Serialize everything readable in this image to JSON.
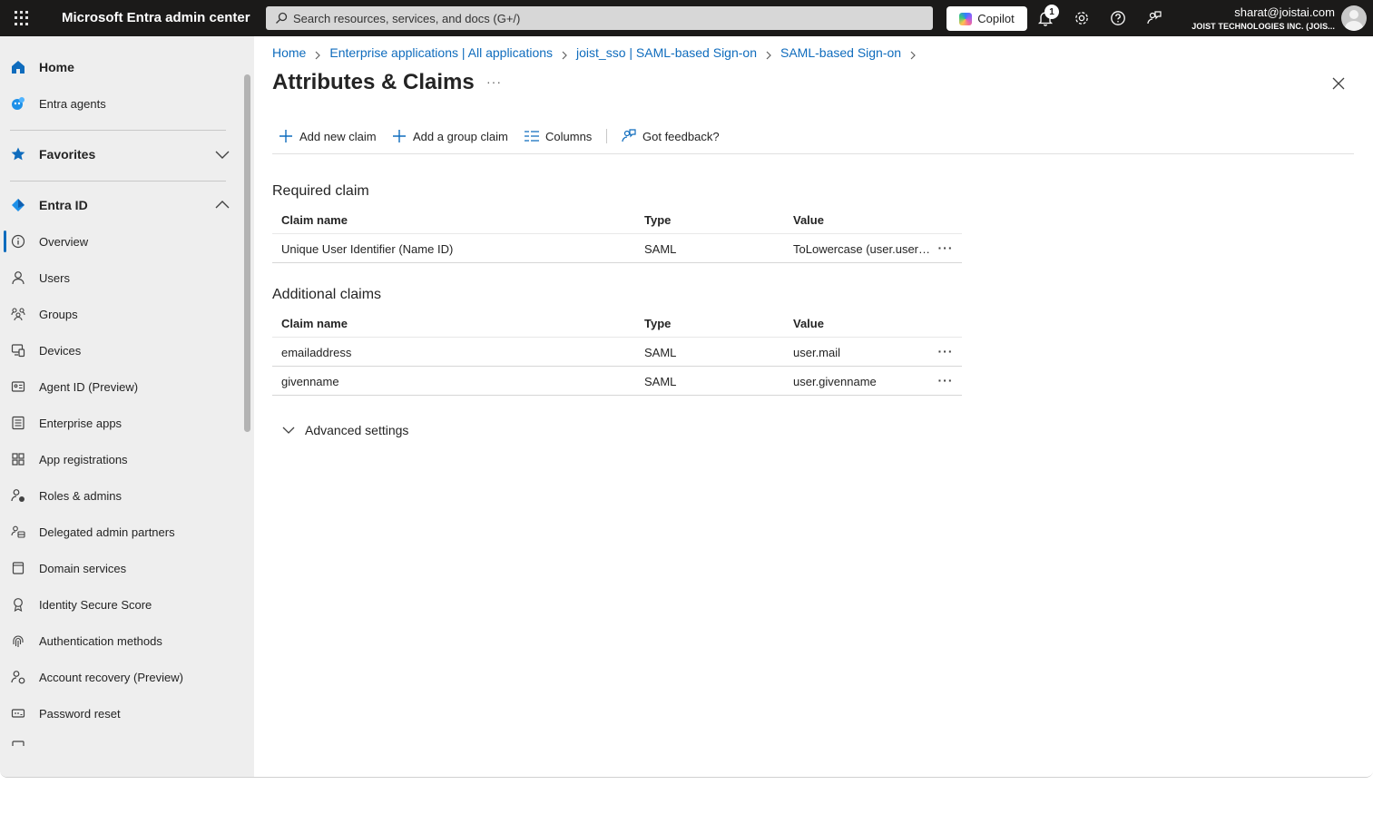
{
  "topbar": {
    "brand": "Microsoft Entra admin center",
    "search_placeholder": "Search resources, services, and docs (G+/)",
    "copilot_label": "Copilot",
    "notification_count": "1",
    "account_email": "sharat@joistai.com",
    "account_tenant": "JOIST TECHNOLOGIES INC. (JOIS..."
  },
  "sidebar": {
    "home": "Home",
    "entra_agents": "Entra agents",
    "favorites": "Favorites",
    "entra_id": "Entra ID",
    "items": [
      {
        "label": "Overview",
        "icon": "info-icon"
      },
      {
        "label": "Users",
        "icon": "user-icon"
      },
      {
        "label": "Groups",
        "icon": "groups-icon"
      },
      {
        "label": "Devices",
        "icon": "devices-icon"
      },
      {
        "label": "Agent ID (Preview)",
        "icon": "id-card-icon"
      },
      {
        "label": "Enterprise apps",
        "icon": "enterprise-apps-icon"
      },
      {
        "label": "App registrations",
        "icon": "app-registrations-icon"
      },
      {
        "label": "Roles & admins",
        "icon": "roles-icon"
      },
      {
        "label": "Delegated admin partners",
        "icon": "partners-icon"
      },
      {
        "label": "Domain services",
        "icon": "domain-services-icon"
      },
      {
        "label": "Identity Secure Score",
        "icon": "trophy-icon"
      },
      {
        "label": "Authentication methods",
        "icon": "fingerprint-icon"
      },
      {
        "label": "Account recovery (Preview)",
        "icon": "account-recovery-icon"
      },
      {
        "label": "Password reset",
        "icon": "password-icon"
      }
    ]
  },
  "breadcrumb": [
    "Home",
    "Enterprise applications | All applications",
    "joist_sso | SAML-based Sign-on",
    "SAML-based Sign-on"
  ],
  "page": {
    "title": "Attributes & Claims",
    "more": "···"
  },
  "toolbar": {
    "add_claim": "Add new claim",
    "add_group_claim": "Add a group claim",
    "columns": "Columns",
    "feedback": "Got feedback?"
  },
  "required": {
    "heading": "Required claim",
    "headers": [
      "Claim name",
      "Type",
      "Value"
    ],
    "rows": [
      {
        "name": "Unique User Identifier (Name ID)",
        "type": "SAML",
        "value": "ToLowercase (user.userp..."
      }
    ]
  },
  "additional": {
    "heading": "Additional claims",
    "headers": [
      "Claim name",
      "Type",
      "Value"
    ],
    "rows": [
      {
        "name": "emailaddress",
        "type": "SAML",
        "value": "user.mail"
      },
      {
        "name": "givenname",
        "type": "SAML",
        "value": "user.givenname"
      }
    ]
  },
  "advanced": {
    "label": "Advanced settings"
  },
  "colors": {
    "topbar": "#1b1a19",
    "accent": "#0f6cbd",
    "sidebar": "#eeeeee"
  }
}
